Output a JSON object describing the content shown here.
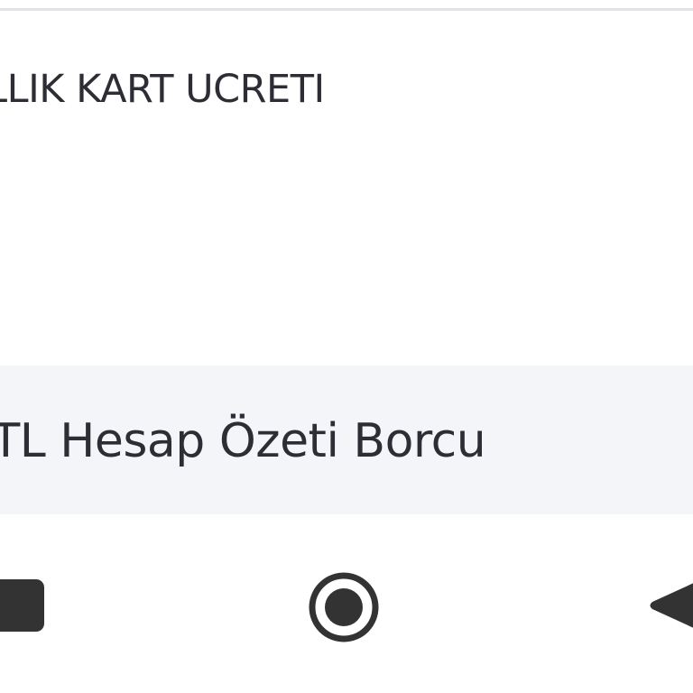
{
  "transaction": {
    "title": "ILLIK KART UCRETI"
  },
  "summary": {
    "label": "n TL Hesap Özeti Borcu"
  },
  "navigation": {
    "icons": {
      "recents": "recents-square-icon",
      "home": "home-circle-icon",
      "back": "back-triangle-icon"
    },
    "colors": {
      "icon": "#333333",
      "summary_background": "#f4f5f9",
      "text": "#2d2e35"
    }
  }
}
